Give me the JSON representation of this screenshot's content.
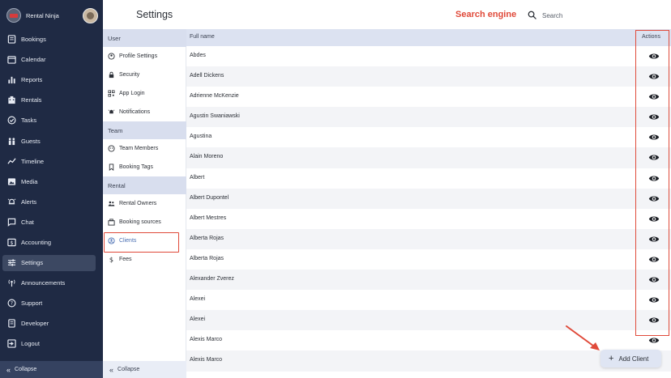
{
  "brand": {
    "name": "Rental Ninja"
  },
  "nav": {
    "items": [
      {
        "label": "Bookings",
        "icon": "bookings-icon"
      },
      {
        "label": "Calendar",
        "icon": "calendar-icon"
      },
      {
        "label": "Reports",
        "icon": "reports-icon"
      },
      {
        "label": "Rentals",
        "icon": "rentals-icon"
      },
      {
        "label": "Tasks",
        "icon": "tasks-icon"
      },
      {
        "label": "Guests",
        "icon": "guests-icon"
      },
      {
        "label": "Timeline",
        "icon": "timeline-icon"
      },
      {
        "label": "Media",
        "icon": "media-icon"
      },
      {
        "label": "Alerts",
        "icon": "alerts-icon"
      },
      {
        "label": "Chat",
        "icon": "chat-icon"
      },
      {
        "label": "Accounting",
        "icon": "accounting-icon"
      },
      {
        "label": "Settings",
        "icon": "settings-icon",
        "active": true
      },
      {
        "label": "Announcements",
        "icon": "announcements-icon"
      },
      {
        "label": "Support",
        "icon": "support-icon"
      },
      {
        "label": "Developer",
        "icon": "developer-icon"
      },
      {
        "label": "Logout",
        "icon": "logout-icon"
      }
    ],
    "collapse": "Collapse"
  },
  "header": {
    "title": "Settings",
    "annotation": "Search engine",
    "search_placeholder": "Search"
  },
  "settings_menu": {
    "sections": [
      {
        "title": "User",
        "items": [
          "Profile Settings",
          "Security",
          "App Login",
          "Notifications"
        ]
      },
      {
        "title": "Team",
        "items": [
          "Team Members",
          "Booking Tags"
        ]
      },
      {
        "title": "Rental",
        "items": [
          "Rental Owners",
          "Booking sources",
          "Clients",
          "Fees"
        ]
      }
    ],
    "active_item": "Clients",
    "collapse": "Collapse"
  },
  "table": {
    "col_name": "Full name",
    "col_actions": "Actions",
    "rows": [
      "Abdes",
      "Adell Dickens",
      "Adrienne McKenzie",
      "Agustin Swaniawski",
      "Agustina",
      "Alain Moreno",
      "Albert",
      "Albert Dupontel",
      "Albert Mestres",
      "Alberta Rojas",
      "Alberta Rojas",
      "Alexander Zverez",
      "Alexei",
      "Alexei",
      "Alexis Marco",
      "Alexis Marco"
    ]
  },
  "fab": {
    "label": "Add Client"
  },
  "colors": {
    "nav_bg": "#1f2a44",
    "accent": "#4a6fb3",
    "annotation": "#e04a3a",
    "section_bg": "#d8deee"
  }
}
